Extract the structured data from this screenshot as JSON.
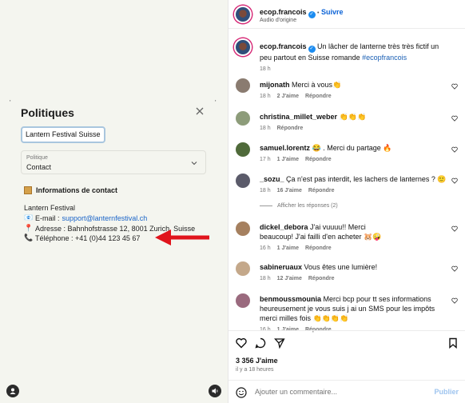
{
  "left": {
    "ticks": [
      "'",
      "'"
    ],
    "title": "Politiques",
    "chip": "Lantern Festival Suisse",
    "select": {
      "label": "Politique",
      "value": "Contact"
    },
    "section_title": "Informations de contact",
    "org": "Lantern Festival",
    "email_label": "E-mail :",
    "email_value": "support@lanternfestival.ch",
    "address": "Adresse : Bahnhofstrasse 12, 8001 Zurich, Suisse",
    "phone": "Téléphone : +41 (0)44 123 45 67",
    "emoji": {
      "email": "📧",
      "pin": "📍",
      "phone": "📞"
    }
  },
  "post": {
    "author": "ecop.francois",
    "follow": "Suivre",
    "dot": "•",
    "audio": "Audio d'origine",
    "caption_user": "ecop.francois",
    "caption": "Un lâcher de lanterne très très fictif un peu partout en Suisse romande",
    "hashtag": "#ecopfrancois",
    "caption_time": "18 h",
    "comments": [
      {
        "user": "mijonath",
        "text": "Merci à vous👏",
        "time": "18 h",
        "likes": "2 J'aime",
        "reply": "Répondre"
      },
      {
        "user": "christina_millet_weber",
        "text": "👏👏👏",
        "time": "18 h",
        "likes": "",
        "reply": "Répondre"
      },
      {
        "user": "samuel.lorentz",
        "text": "😂 . Merci du partage 🔥",
        "time": "17 h",
        "likes": "1 J'aime",
        "reply": "Répondre"
      },
      {
        "user": "_sozu_",
        "text": "Ça n'est pas interdit, les lachers de lanternes ? 🙂",
        "time": "18 h",
        "likes": "16 J'aime",
        "reply": "Répondre"
      },
      {
        "user": "dickel_debora",
        "text": "J'ai vuuuu!! Merci beaucoup! J'ai failli d'en acheter 🐹🤪",
        "time": "16 h",
        "likes": "1 J'aime",
        "reply": "Répondre"
      },
      {
        "user": "sabineruaux",
        "text": "Vous êtes une lumière!",
        "time": "18 h",
        "likes": "12 J'aime",
        "reply": "Répondre"
      },
      {
        "user": "benmoussmounia",
        "text": "Merci bcp pour tt ses informations heureusement je vous suis j ai un SMS pour les impôts merci milles fois 👏👏👏👏",
        "time": "16 h",
        "likes": "1 J'aime",
        "reply": "Répondre"
      }
    ],
    "show_replies": "Afficher les réponses (2)",
    "likes_count": "3 356 J'aime",
    "posted_ago": "il y a 18 heures",
    "comment_placeholder": "Ajouter un commentaire...",
    "publish": "Publier"
  },
  "colors": {
    "accent": "#0a62d6",
    "arrow": "#e0141c",
    "panel": "#f4f5ef"
  }
}
